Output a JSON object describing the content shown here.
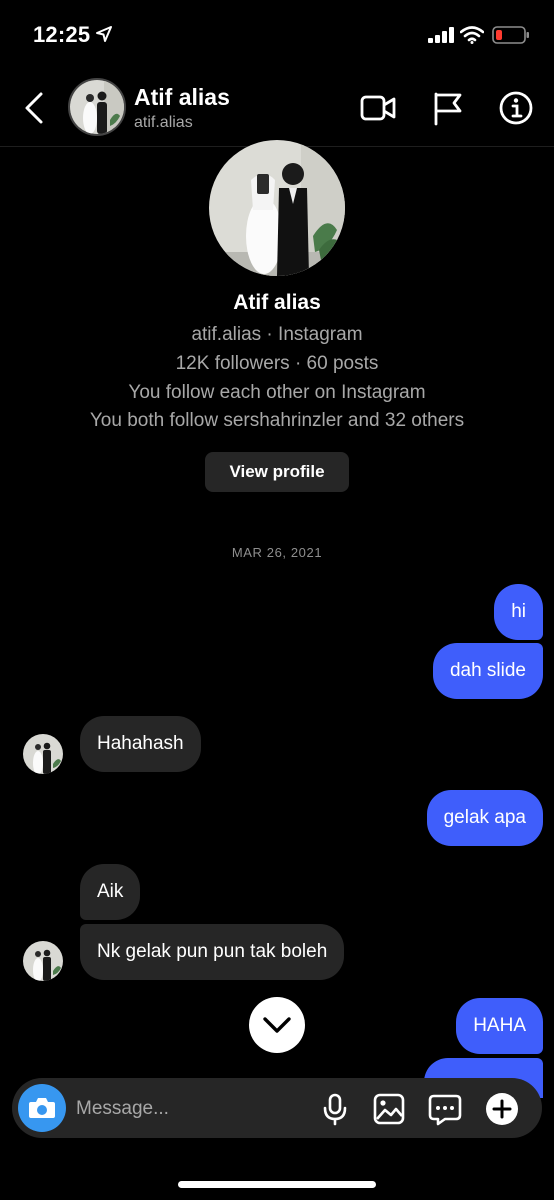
{
  "status_bar": {
    "time": "12:25"
  },
  "header": {
    "name": "Atif alias",
    "username": "atif.alias",
    "icons": [
      "back-icon",
      "video-call-icon",
      "flag-icon",
      "info-icon"
    ]
  },
  "profile": {
    "name": "Atif alias",
    "subtitle": "atif.alias · Instagram",
    "stats": "12K followers · 60 posts",
    "relationship": "You follow each other on Instagram",
    "mutuals": "You both follow sershahrinzler and 32 others",
    "view_profile_label": "View profile"
  },
  "chat": {
    "date": "MAR 26, 2021",
    "messages": [
      {
        "from": "me",
        "text": "hi"
      },
      {
        "from": "me",
        "text": "dah slide"
      },
      {
        "from": "them",
        "text": "Hahahash"
      },
      {
        "from": "me",
        "text": "gelak apa"
      },
      {
        "from": "them",
        "text": "Aik"
      },
      {
        "from": "them",
        "text": "Nk gelak pun pun tak boleh"
      },
      {
        "from": "me",
        "text": "HAHA"
      }
    ]
  },
  "composer": {
    "placeholder": "Message...",
    "icons": [
      "camera-icon",
      "microphone-icon",
      "gallery-icon",
      "sticker-icon",
      "plus-icon"
    ]
  },
  "colors": {
    "sent_bubble": "#3f5efb",
    "received_bubble": "#262626",
    "camera_button": "#3797f0",
    "background": "#000000"
  }
}
